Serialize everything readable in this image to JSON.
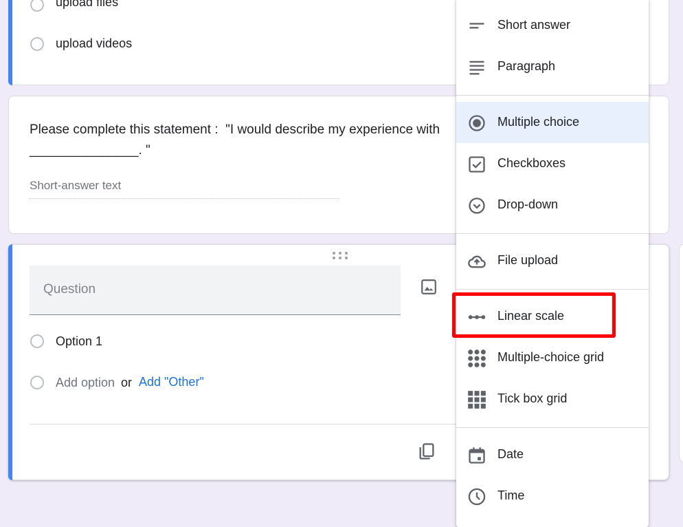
{
  "card1": {
    "options": [
      "upload files",
      "upload videos"
    ]
  },
  "card2": {
    "question": "Please complete this statement :  \"I would describe my experience with",
    "question_line2": "_______________. \"",
    "answer_placeholder": "Short-answer text"
  },
  "card3": {
    "question_placeholder": "Question",
    "option1": "Option 1",
    "add_option": "Add option",
    "or": "or",
    "add_other": "Add \"Other\""
  },
  "menu": {
    "items": [
      {
        "label": "Short answer",
        "icon": "short-answer-icon"
      },
      {
        "label": "Paragraph",
        "icon": "paragraph-icon"
      },
      {
        "label": "Multiple choice",
        "icon": "radio-button-icon",
        "selected": true
      },
      {
        "label": "Checkboxes",
        "icon": "checkbox-icon"
      },
      {
        "label": "Drop-down",
        "icon": "dropdown-circle-icon"
      },
      {
        "label": "File upload",
        "icon": "cloud-upload-icon"
      },
      {
        "label": "Linear scale",
        "icon": "linear-scale-icon",
        "highlighted": true
      },
      {
        "label": "Multiple-choice grid",
        "icon": "dot-grid-icon"
      },
      {
        "label": "Tick box grid",
        "icon": "square-grid-icon"
      },
      {
        "label": "Date",
        "icon": "calendar-icon"
      },
      {
        "label": "Time",
        "icon": "clock-icon"
      }
    ]
  },
  "colors": {
    "background": "#f0ebf8",
    "accent": "#4285f4",
    "link": "#1a73e8",
    "selected_item": "#e8f0fe",
    "highlight_box": "#ff0000"
  }
}
